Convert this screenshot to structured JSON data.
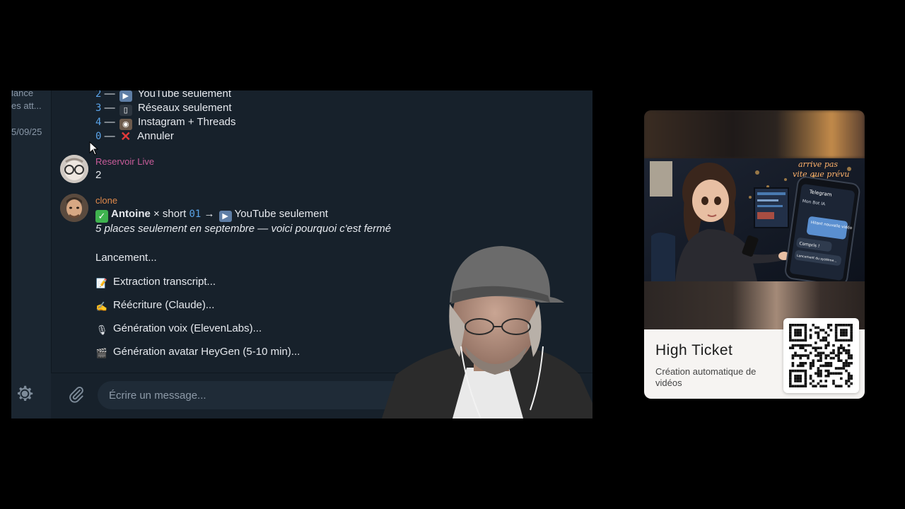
{
  "sidebar": {
    "snippets": [
      "lance",
      "es att...",
      "5/09/25"
    ]
  },
  "options": [
    {
      "num": "2",
      "label": "YouTube seulement",
      "icon": "play-icon"
    },
    {
      "num": "3",
      "label": "Réseaux seulement",
      "icon": "phone-icon"
    },
    {
      "num": "4",
      "label": "Instagram + Threads",
      "icon": "camera-icon"
    },
    {
      "num": "0",
      "label": "Annuler",
      "icon": "cross-icon"
    }
  ],
  "messages": [
    {
      "sender": "Reservoir Live",
      "sender_color": "#c85c9a",
      "text": "2"
    },
    {
      "sender": "clone",
      "sender_color": "#e0894a",
      "line1_name": "Antoine",
      "line1_mid": " × short ",
      "line1_code": "01",
      "line1_arrow": " → ",
      "line1_target": "YouTube seulement",
      "line2": "5 places seulement en septembre — voici pourquoi c'est fermé",
      "status": "Lancement...",
      "steps": [
        {
          "icon": "memo-icon",
          "glyph": "📝",
          "label": "Extraction transcript..."
        },
        {
          "icon": "writing-hand-icon",
          "glyph": "✍",
          "label": "Réécriture (Claude)..."
        },
        {
          "icon": "microphone-icon",
          "glyph": "🎙",
          "label": "Génération voix (ElevenLabs)..."
        },
        {
          "icon": "clapper-icon",
          "glyph": "🎬",
          "label": "Génération avatar HeyGen (5-10 min)..."
        }
      ]
    }
  ],
  "composer": {
    "placeholder": "Écrire un message..."
  },
  "promo": {
    "title": "High Ticket",
    "subtitle": "Création automatique de vidéos",
    "neon_text": [
      "arrive pas",
      "vite que prévu"
    ],
    "phone_app": "Telegram",
    "phone_chat": "Mon Bot IA",
    "phone_bubble1": "Hitant nouvelle vidéo",
    "phone_bubble2": "Compris !",
    "phone_bubble3": "Lancement du système..."
  },
  "colors": {
    "chat_bg": "#17212b",
    "accent_blue": "#5aa3e8",
    "checkmark_green": "#3fb34f"
  }
}
